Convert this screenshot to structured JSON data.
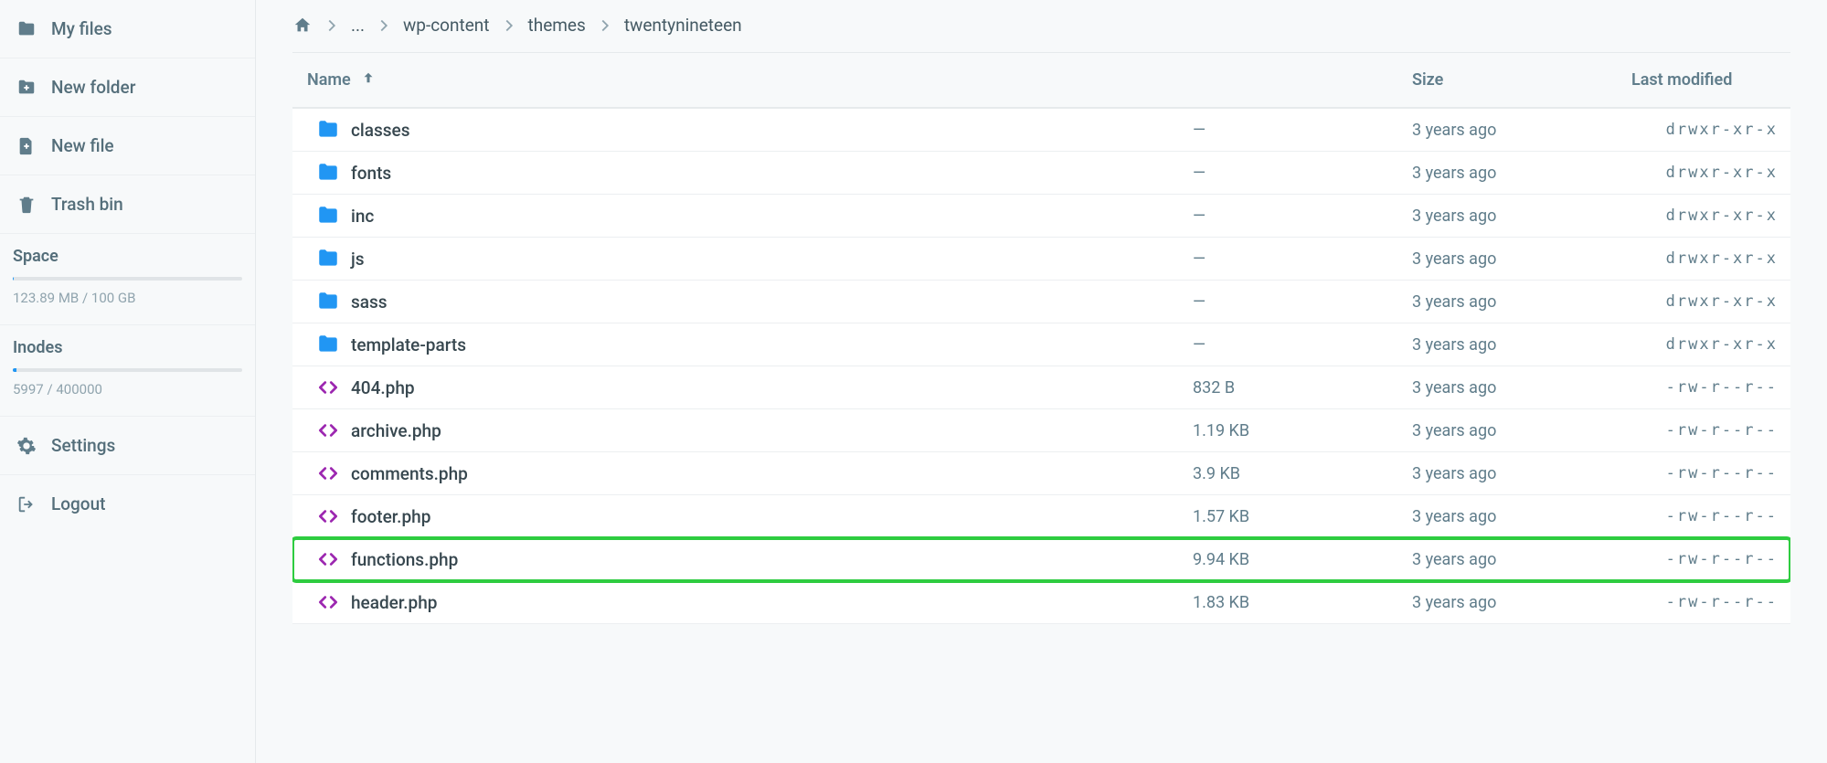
{
  "sidebar": {
    "items": [
      {
        "key": "my-files",
        "label": "My files"
      },
      {
        "key": "new-folder",
        "label": "New folder"
      },
      {
        "key": "new-file",
        "label": "New file"
      },
      {
        "key": "trash-bin",
        "label": "Trash bin"
      }
    ],
    "space": {
      "title": "Space",
      "text": "123.89 MB / 100 GB",
      "percent": 0.12
    },
    "inodes": {
      "title": "Inodes",
      "text": "5997 / 400000",
      "percent": 1.5
    },
    "bottom": [
      {
        "key": "settings",
        "label": "Settings"
      },
      {
        "key": "logout",
        "label": "Logout"
      }
    ]
  },
  "breadcrumbs": {
    "ellipsis": "...",
    "items": [
      "wp-content",
      "themes",
      "twentynineteen"
    ]
  },
  "columns": {
    "name": "Name",
    "size": "Size",
    "modified": "Last modified"
  },
  "rows": [
    {
      "type": "folder",
      "name": "classes",
      "size": "—",
      "modified": "3 years ago",
      "perm": "drwxr-xr-x"
    },
    {
      "type": "folder",
      "name": "fonts",
      "size": "—",
      "modified": "3 years ago",
      "perm": "drwxr-xr-x"
    },
    {
      "type": "folder",
      "name": "inc",
      "size": "—",
      "modified": "3 years ago",
      "perm": "drwxr-xr-x"
    },
    {
      "type": "folder",
      "name": "js",
      "size": "—",
      "modified": "3 years ago",
      "perm": "drwxr-xr-x"
    },
    {
      "type": "folder",
      "name": "sass",
      "size": "—",
      "modified": "3 years ago",
      "perm": "drwxr-xr-x"
    },
    {
      "type": "folder",
      "name": "template-parts",
      "size": "—",
      "modified": "3 years ago",
      "perm": "drwxr-xr-x"
    },
    {
      "type": "code",
      "name": "404.php",
      "size": "832 B",
      "modified": "3 years ago",
      "perm": "-rw-r--r--"
    },
    {
      "type": "code",
      "name": "archive.php",
      "size": "1.19 KB",
      "modified": "3 years ago",
      "perm": "-rw-r--r--"
    },
    {
      "type": "code",
      "name": "comments.php",
      "size": "3.9 KB",
      "modified": "3 years ago",
      "perm": "-rw-r--r--"
    },
    {
      "type": "code",
      "name": "footer.php",
      "size": "1.57 KB",
      "modified": "3 years ago",
      "perm": "-rw-r--r--"
    },
    {
      "type": "code",
      "name": "functions.php",
      "size": "9.94 KB",
      "modified": "3 years ago",
      "perm": "-rw-r--r--",
      "highlight": true
    },
    {
      "type": "code",
      "name": "header.php",
      "size": "1.83 KB",
      "modified": "3 years ago",
      "perm": "-rw-r--r--"
    }
  ]
}
